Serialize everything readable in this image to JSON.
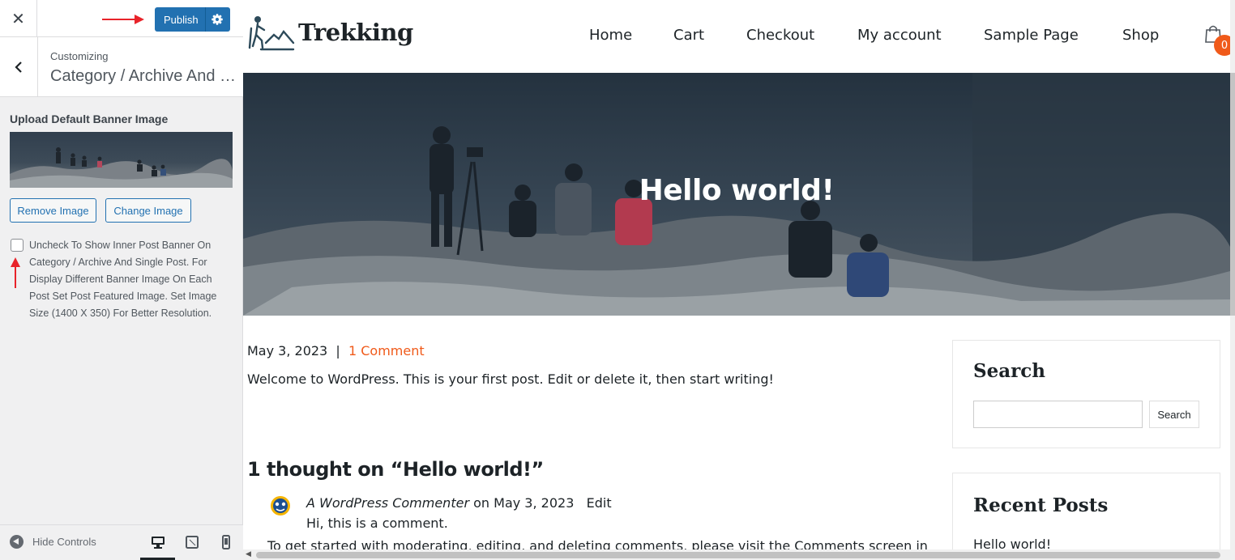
{
  "customizer": {
    "close_icon": "close-icon",
    "publish_label": "Publish",
    "settings_icon": "gear-icon",
    "breadcrumb": "Customizing",
    "section_title": "Category / Archive And S...",
    "control_label": "Upload Default Banner Image",
    "remove_image_label": "Remove Image",
    "change_image_label": "Change Image",
    "checkbox_checked": false,
    "checkbox_description": "Uncheck To Show Inner Post Banner On Category / Archive And Single Post. For Display Different Banner Image On Each Post Set Post Featured Image. Set Image Size (1400 X 350) For Better Resolution.",
    "hide_controls_label": "Hide Controls",
    "devices": [
      "desktop",
      "tablet",
      "mobile"
    ],
    "active_device": "desktop",
    "accent_color": "#2271b1",
    "annotation_color": "#e8232a"
  },
  "site": {
    "logo_text": "Trekking",
    "nav": [
      "Home",
      "Cart",
      "Checkout",
      "My account",
      "Sample Page",
      "Shop"
    ],
    "cart_count": "0",
    "accent_color": "#f05a1a"
  },
  "post": {
    "hero_title": "Hello world!",
    "date": "May 3, 2023",
    "meta_separator": "|",
    "comment_link": "1 Comment",
    "excerpt": "Welcome to WordPress. This is your first post. Edit or delete it, then start writing!",
    "comments_title": "1 thought on “Hello world!”",
    "comment": {
      "author": "A WordPress Commenter",
      "on_label": "on",
      "date": "May 3, 2023",
      "edit_label": "Edit",
      "body": "Hi, this is a comment.",
      "more": "To get started with moderating, editing, and deleting comments, please visit the Comments screen in"
    }
  },
  "widgets": {
    "search_title": "Search",
    "search_button": "Search",
    "recent_title": "Recent Posts",
    "recent_items": [
      "Hello world!"
    ]
  }
}
